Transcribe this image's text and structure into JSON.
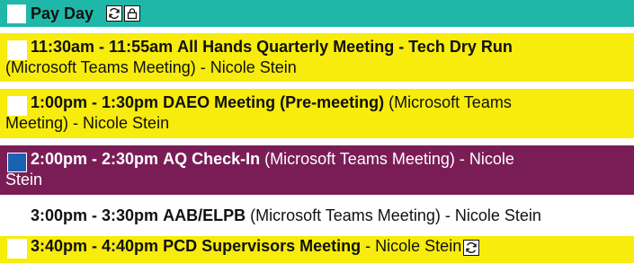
{
  "header": {
    "title": "Pay Day",
    "icons": [
      "recurring-icon",
      "lock-icon"
    ],
    "color": "#1fb8a8"
  },
  "events": [
    {
      "time": "11:30am - 11:55am",
      "title": "All Hands Quarterly Meeting - Tech Dry Run",
      "line2": "(Microsoft Teams Meeting) - Nicole Stein",
      "color": "#f7ec0b"
    },
    {
      "time": "1:00pm - 1:30pm",
      "title": "DAEO Meeting (Pre-meeting)",
      "line1_rest": "(Microsoft Teams",
      "line2": "Meeting) - Nicole Stein",
      "color": "#f7ec0b"
    },
    {
      "time": "2:00pm - 2:30pm",
      "title": "AQ Check-In",
      "line1_rest": "(Microsoft Teams Meeting) - Nicole",
      "line2": "Stein",
      "color": "#7a1d57"
    },
    {
      "time": "3:00pm - 3:30pm",
      "title": "AAB/ELPB",
      "line1_rest": "(Microsoft Teams Meeting) - Nicole Stein"
    },
    {
      "time": "3:40pm - 4:40pm",
      "title": "PCD Supervisors Meeting",
      "line1_rest": "- Nicole Stein",
      "color": "#f7ec0b",
      "icon": "recurring-icon"
    }
  ]
}
